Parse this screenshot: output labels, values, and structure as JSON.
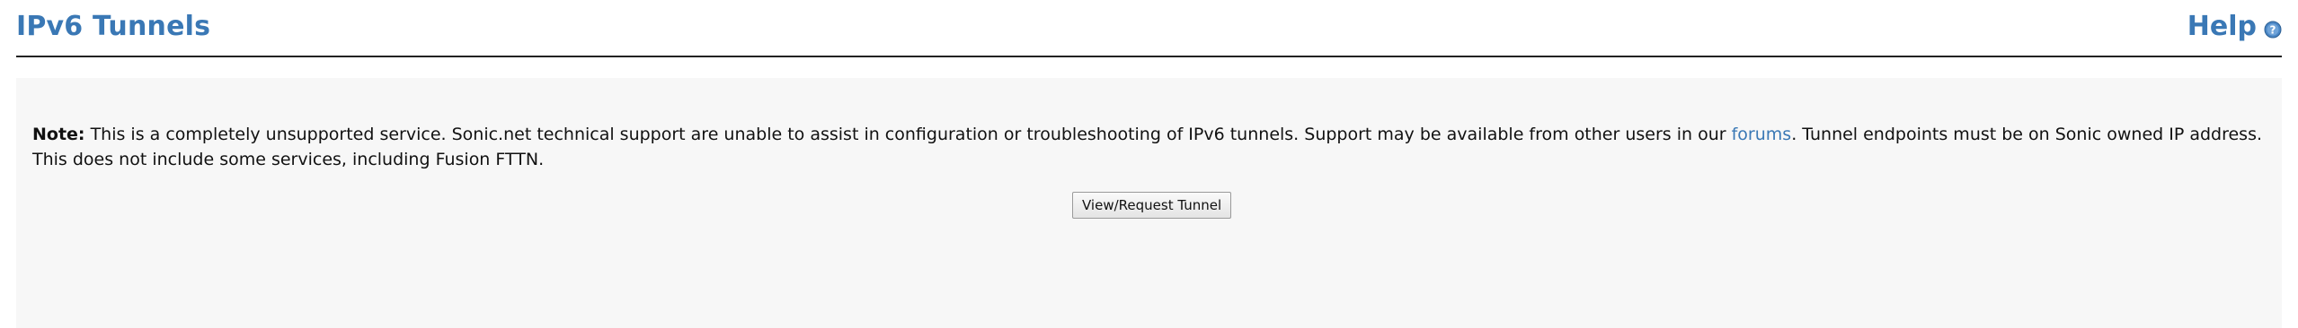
{
  "header": {
    "title": "IPv6 Tunnels",
    "help_label": "Help",
    "help_icon": "help-icon",
    "accent_color": "#3a78b5"
  },
  "note": {
    "label": "Note:",
    "text_before_link": " This is a completely unsupported service. Sonic.net technical support are unable to assist in configuration or troubleshooting of IPv6 tunnels. Support may be available from other users in our ",
    "link_text": "forums",
    "text_after_link": ". Tunnel endpoints must be on Sonic owned IP address. This does not include some services, including Fusion FTTN."
  },
  "actions": {
    "view_request_label": "View/Request Tunnel"
  }
}
